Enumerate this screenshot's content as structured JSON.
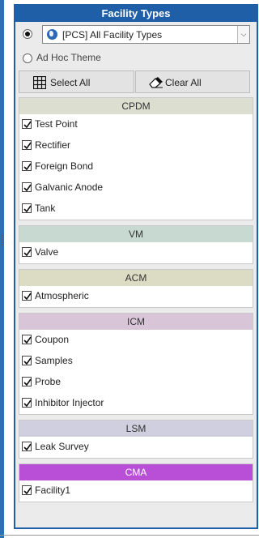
{
  "panel": {
    "title": "Facility Types",
    "select": {
      "value": "[PCS] All Facility Types",
      "arrow": "⌵"
    },
    "adhoc_label": "Ad Hoc Theme",
    "select_all_label": "Select All",
    "clear_all_label": "Clear All"
  },
  "colors": {
    "header_blue": "#1f5fa8",
    "cpdm": "#dcdfd0",
    "vm": "#c7d9d0",
    "acm": "#dcdcc4",
    "icm": "#d8c6d8",
    "lsm": "#cfcfe0",
    "cma": "#b84fd6"
  },
  "groups": [
    {
      "name": "CPDM",
      "items": [
        "Test Point",
        "Rectifier",
        "Foreign Bond",
        "Galvanic Anode",
        "Tank"
      ]
    },
    {
      "name": "VM",
      "items": [
        "Valve"
      ]
    },
    {
      "name": "ACM",
      "items": [
        "Atmospheric"
      ]
    },
    {
      "name": "ICM",
      "items": [
        "Coupon",
        "Samples",
        "Probe",
        "Inhibitor Injector"
      ]
    },
    {
      "name": "LSM",
      "items": [
        "Leak Survey"
      ]
    },
    {
      "name": "CMA",
      "items": [
        "Facility1"
      ]
    }
  ]
}
